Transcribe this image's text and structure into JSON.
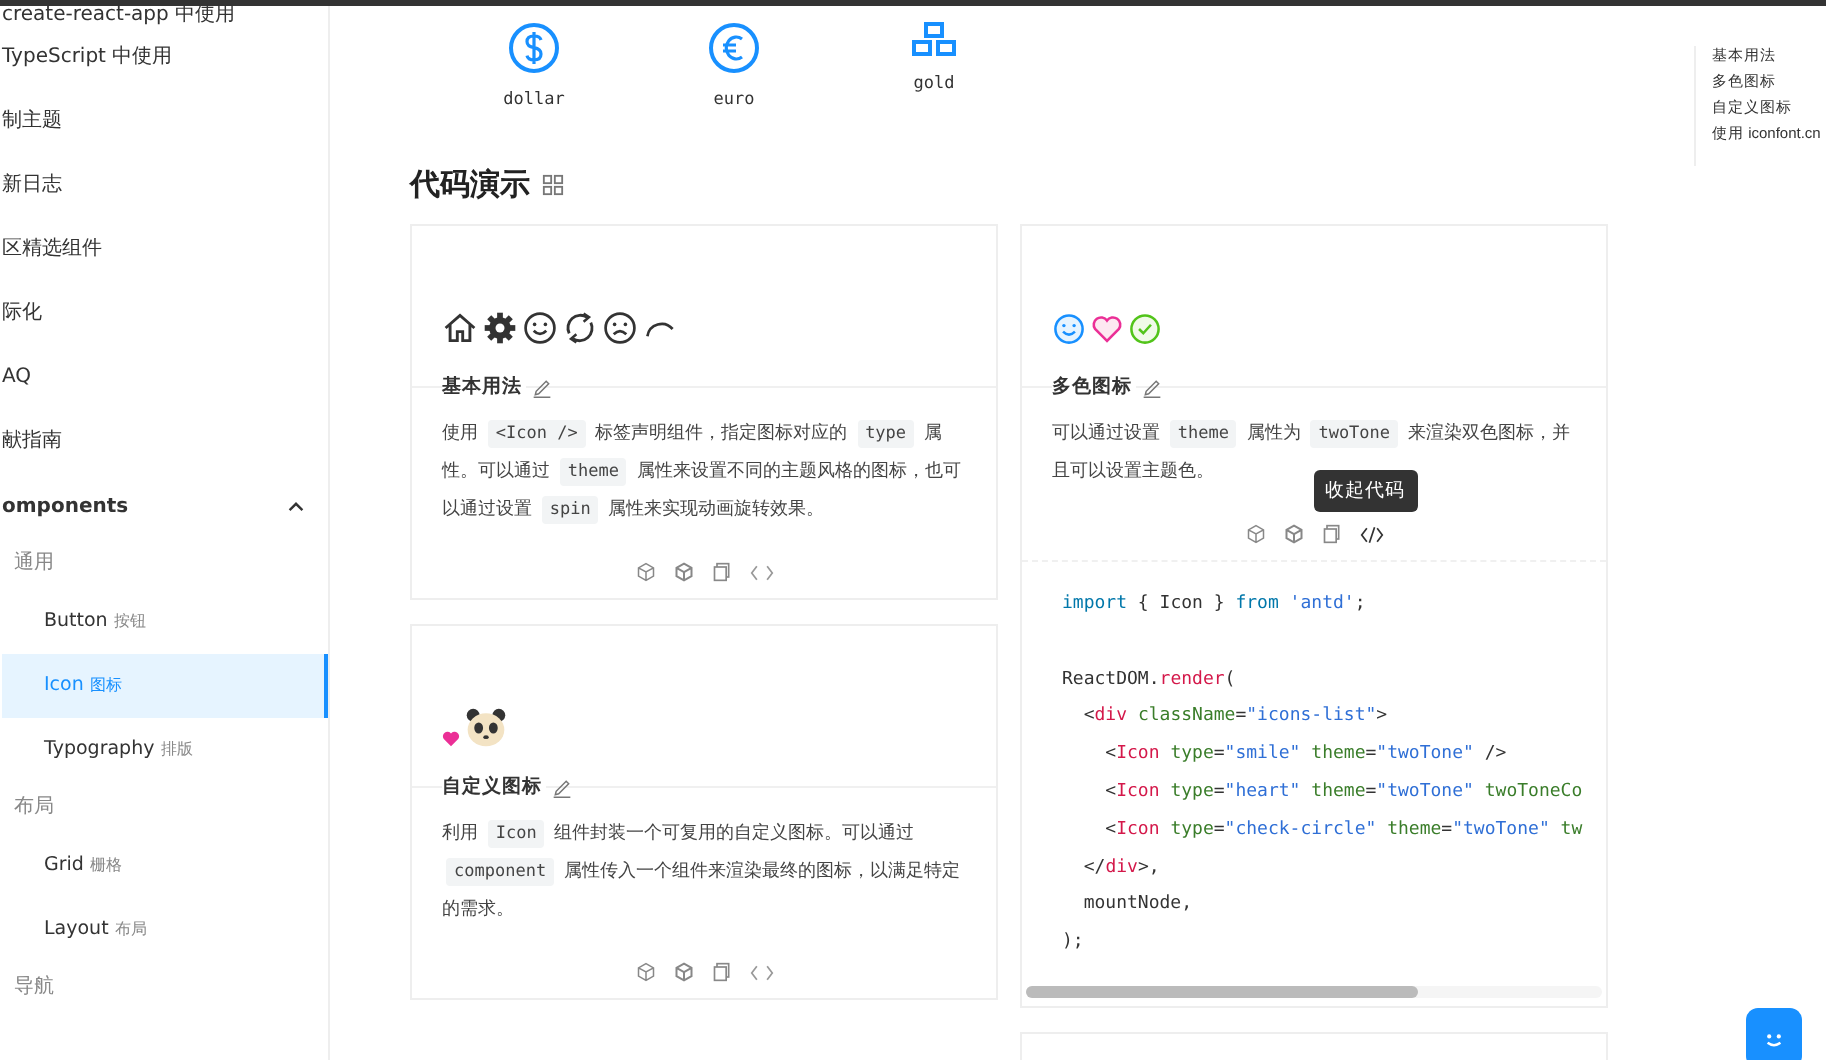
{
  "sidebar": {
    "items": [
      {
        "label": "create-react-app 中使用"
      },
      {
        "label": "TypeScript 中使用"
      },
      {
        "label": "制主题"
      },
      {
        "label": "新日志"
      },
      {
        "label": "区精选组件"
      },
      {
        "label": "际化"
      },
      {
        "label": "AQ"
      },
      {
        "label": "献指南"
      }
    ],
    "group": {
      "label": "omponents",
      "expanded": true,
      "sections": [
        {
          "label": "通用",
          "items": [
            {
              "name": "Button",
              "sub": "按钮",
              "selected": false
            },
            {
              "name": "Icon",
              "sub": "图标",
              "selected": true
            },
            {
              "name": "Typography",
              "sub": "排版",
              "selected": false
            }
          ]
        },
        {
          "label": "布局",
          "items": [
            {
              "name": "Grid",
              "sub": "栅格",
              "selected": false
            },
            {
              "name": "Layout",
              "sub": "布局",
              "selected": false
            }
          ]
        },
        {
          "label": "导航"
        }
      ]
    }
  },
  "currency_icons": [
    {
      "kind": "dollar",
      "label": "dollar"
    },
    {
      "kind": "euro",
      "label": "euro"
    },
    {
      "kind": "gold",
      "label": "gold"
    }
  ],
  "section_title": "代码演示",
  "columns": [
    [
      {
        "kind": "basic",
        "title": "基本用法",
        "description": [
          {
            "kind": "text",
            "text": "使用 "
          },
          {
            "kind": "code",
            "text": "<Icon />"
          },
          {
            "kind": "text",
            "text": " 标签声明组件，指定图标对应的 "
          },
          {
            "kind": "code",
            "text": "type"
          },
          {
            "kind": "text",
            "text": " 属性。可以通过 "
          },
          {
            "kind": "code",
            "text": "theme"
          },
          {
            "kind": "text",
            "text": " 属性来设置不同的主题风格的图标，也可以通过设置 "
          },
          {
            "kind": "code",
            "text": "spin"
          },
          {
            "kind": "text",
            "text": " 属性来实现动画旋转效果。"
          }
        ]
      },
      {
        "kind": "custom",
        "title": "自定义图标",
        "description": [
          {
            "kind": "text",
            "text": "利用 "
          },
          {
            "kind": "code",
            "text": "Icon"
          },
          {
            "kind": "text",
            "text": " 组件封装一个可复用的自定义图标。可以通过 "
          },
          {
            "kind": "code",
            "text": "component"
          },
          {
            "kind": "text",
            "text": " 属性传入一个组件来渲染最终的图标，以满足特定的需求。"
          }
        ]
      }
    ],
    [
      {
        "kind": "twotone",
        "title": "多色图标",
        "description": [
          {
            "kind": "text",
            "text": "可以通过设置 "
          },
          {
            "kind": "code",
            "text": "theme"
          },
          {
            "kind": "text",
            "text": " 属性为 "
          },
          {
            "kind": "code",
            "text": "twoTone"
          },
          {
            "kind": "text",
            "text": " 来渲染双色图标，并且可以设置主题色。"
          }
        ],
        "tooltip": "收起代码",
        "code_expanded": true,
        "code": [
          [
            {
              "kind": "keyword",
              "text": "import"
            },
            {
              "kind": "plain",
              "text": " { Icon } "
            },
            {
              "kind": "keyword",
              "text": "from"
            },
            {
              "kind": "string",
              "text": " 'antd'"
            },
            {
              "kind": "plain",
              "text": ";"
            }
          ],
          [
            {
              "kind": "blank"
            }
          ],
          [
            {
              "kind": "plain",
              "text": "ReactDOM."
            },
            {
              "kind": "func",
              "text": "render"
            },
            {
              "kind": "plain",
              "text": "("
            }
          ],
          [
            {
              "kind": "plain",
              "text": "  <"
            },
            {
              "kind": "tag",
              "text": "div"
            },
            {
              "kind": "attr",
              "text": " className"
            },
            {
              "kind": "plain",
              "text": "="
            },
            {
              "kind": "string",
              "text": "\"icons-list\""
            },
            {
              "kind": "plain",
              "text": ">"
            }
          ],
          [
            {
              "kind": "plain",
              "text": "    <"
            },
            {
              "kind": "tag",
              "text": "Icon"
            },
            {
              "kind": "attr",
              "text": " type"
            },
            {
              "kind": "plain",
              "text": "="
            },
            {
              "kind": "string",
              "text": "\"smile\""
            },
            {
              "kind": "attr",
              "text": " theme"
            },
            {
              "kind": "plain",
              "text": "="
            },
            {
              "kind": "string",
              "text": "\"twoTone\""
            },
            {
              "kind": "plain",
              "text": " />"
            }
          ],
          [
            {
              "kind": "plain",
              "text": "    <"
            },
            {
              "kind": "tag",
              "text": "Icon"
            },
            {
              "kind": "attr",
              "text": " type"
            },
            {
              "kind": "plain",
              "text": "="
            },
            {
              "kind": "string",
              "text": "\"heart\""
            },
            {
              "kind": "attr",
              "text": " theme"
            },
            {
              "kind": "plain",
              "text": "="
            },
            {
              "kind": "string",
              "text": "\"twoTone\""
            },
            {
              "kind": "attr",
              "text": " twoToneCo"
            }
          ],
          [
            {
              "kind": "plain",
              "text": "    <"
            },
            {
              "kind": "tag",
              "text": "Icon"
            },
            {
              "kind": "attr",
              "text": " type"
            },
            {
              "kind": "plain",
              "text": "="
            },
            {
              "kind": "string",
              "text": "\"check-circle\""
            },
            {
              "kind": "attr",
              "text": " theme"
            },
            {
              "kind": "plain",
              "text": "="
            },
            {
              "kind": "string",
              "text": "\"twoTone\""
            },
            {
              "kind": "attr",
              "text": " tw"
            }
          ],
          [
            {
              "kind": "plain",
              "text": "  </"
            },
            {
              "kind": "tag",
              "text": "div"
            },
            {
              "kind": "plain",
              "text": ">,"
            }
          ],
          [
            {
              "kind": "plain",
              "text": "  mountNode,"
            }
          ],
          [
            {
              "kind": "plain",
              "text": ");"
            }
          ]
        ]
      },
      {
        "kind": "stub"
      }
    ]
  ],
  "anchor_nav": [
    "基本用法",
    "多色图标",
    "自定义图标",
    "使用 iconfont.cn"
  ]
}
